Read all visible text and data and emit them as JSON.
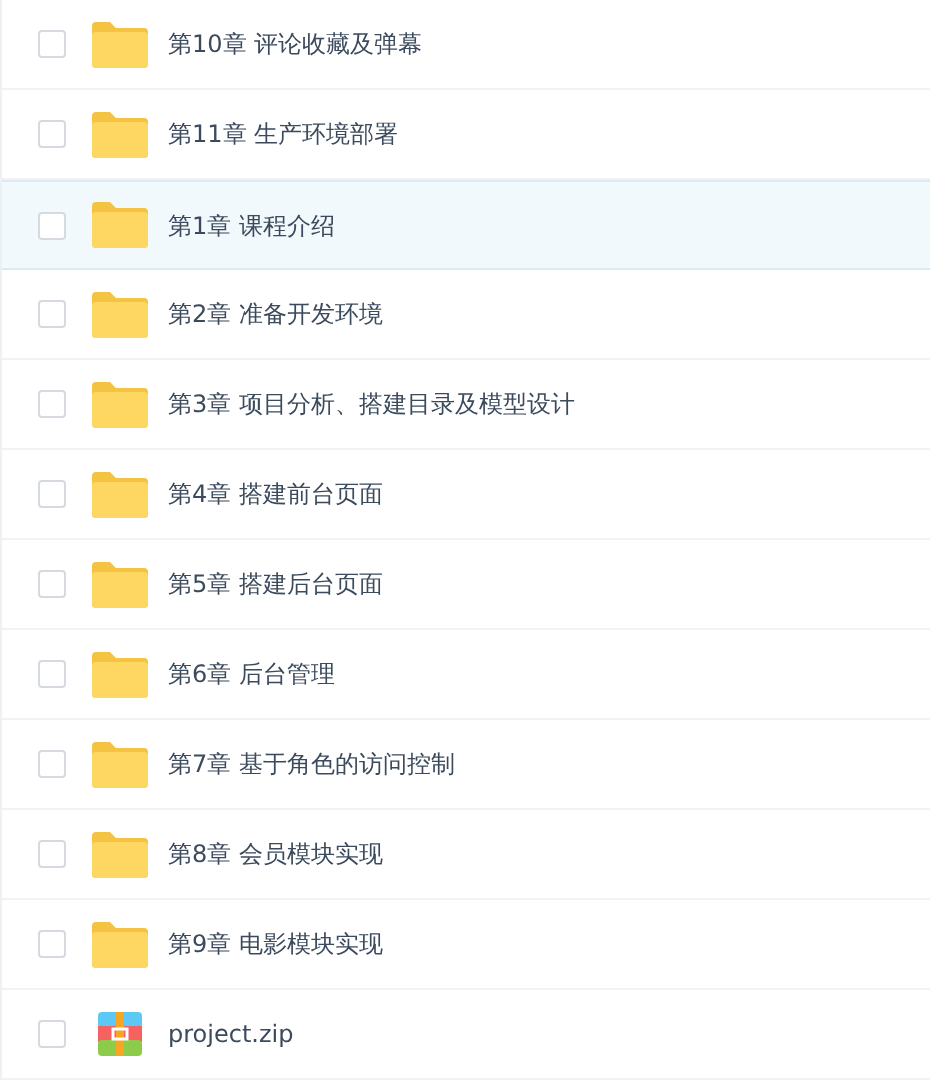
{
  "files": [
    {
      "kind": "folder",
      "name": "第10章 评论收藏及弹幕",
      "checked": false,
      "highlighted": false
    },
    {
      "kind": "folder",
      "name": "第11章 生产环境部署",
      "checked": false,
      "highlighted": false
    },
    {
      "kind": "folder",
      "name": "第1章 课程介绍",
      "checked": false,
      "highlighted": true
    },
    {
      "kind": "folder",
      "name": "第2章 准备开发环境",
      "checked": false,
      "highlighted": false
    },
    {
      "kind": "folder",
      "name": "第3章 项目分析、搭建目录及模型设计",
      "checked": false,
      "highlighted": false
    },
    {
      "kind": "folder",
      "name": "第4章 搭建前台页面",
      "checked": false,
      "highlighted": false
    },
    {
      "kind": "folder",
      "name": "第5章 搭建后台页面",
      "checked": false,
      "highlighted": false
    },
    {
      "kind": "folder",
      "name": "第6章 后台管理",
      "checked": false,
      "highlighted": false
    },
    {
      "kind": "folder",
      "name": "第7章 基于角色的访问控制",
      "checked": false,
      "highlighted": false
    },
    {
      "kind": "folder",
      "name": "第8章 会员模块实现",
      "checked": false,
      "highlighted": false
    },
    {
      "kind": "folder",
      "name": "第9章 电影模块实现",
      "checked": false,
      "highlighted": false
    },
    {
      "kind": "zip",
      "name": "project.zip",
      "checked": false,
      "highlighted": false
    }
  ]
}
